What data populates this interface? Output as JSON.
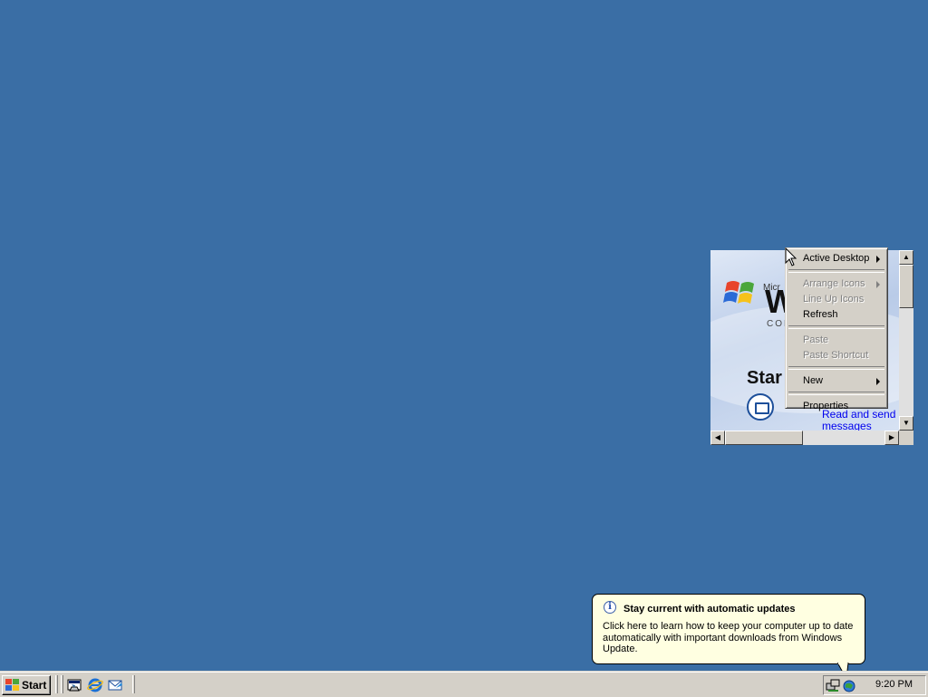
{
  "desktop": {
    "background_color": "#3a6ea5"
  },
  "active_desktop_item": {
    "link_text": "Read and send messages",
    "heading_fragment": "Star",
    "brand_small": "Micr",
    "brand_big": "W",
    "brand_sub": "COD"
  },
  "context_menu": {
    "items": [
      {
        "label": "Active Desktop",
        "enabled": true,
        "submenu": true
      },
      {
        "label": "Arrange Icons",
        "enabled": false,
        "submenu": true
      },
      {
        "label": "Line Up Icons",
        "enabled": false,
        "submenu": false
      },
      {
        "label": "Refresh",
        "enabled": true,
        "submenu": false
      },
      {
        "label": "Paste",
        "enabled": false,
        "submenu": false
      },
      {
        "label": "Paste Shortcut",
        "enabled": false,
        "submenu": false
      },
      {
        "label": "New",
        "enabled": true,
        "submenu": true
      },
      {
        "label": "Properties",
        "enabled": true,
        "submenu": false
      }
    ]
  },
  "balloon": {
    "title": "Stay current with automatic updates",
    "body": "Click here to learn how to keep your computer up to date automatically with important downloads from Windows Update.",
    "icon": "info-icon"
  },
  "taskbar": {
    "start_label": "Start",
    "quick_launch": [
      "show-desktop-icon",
      "internet-explorer-icon",
      "outlook-express-icon"
    ],
    "tray_icons": [
      "network-icon",
      "windows-update-icon"
    ],
    "clock": "9:20 PM"
  }
}
